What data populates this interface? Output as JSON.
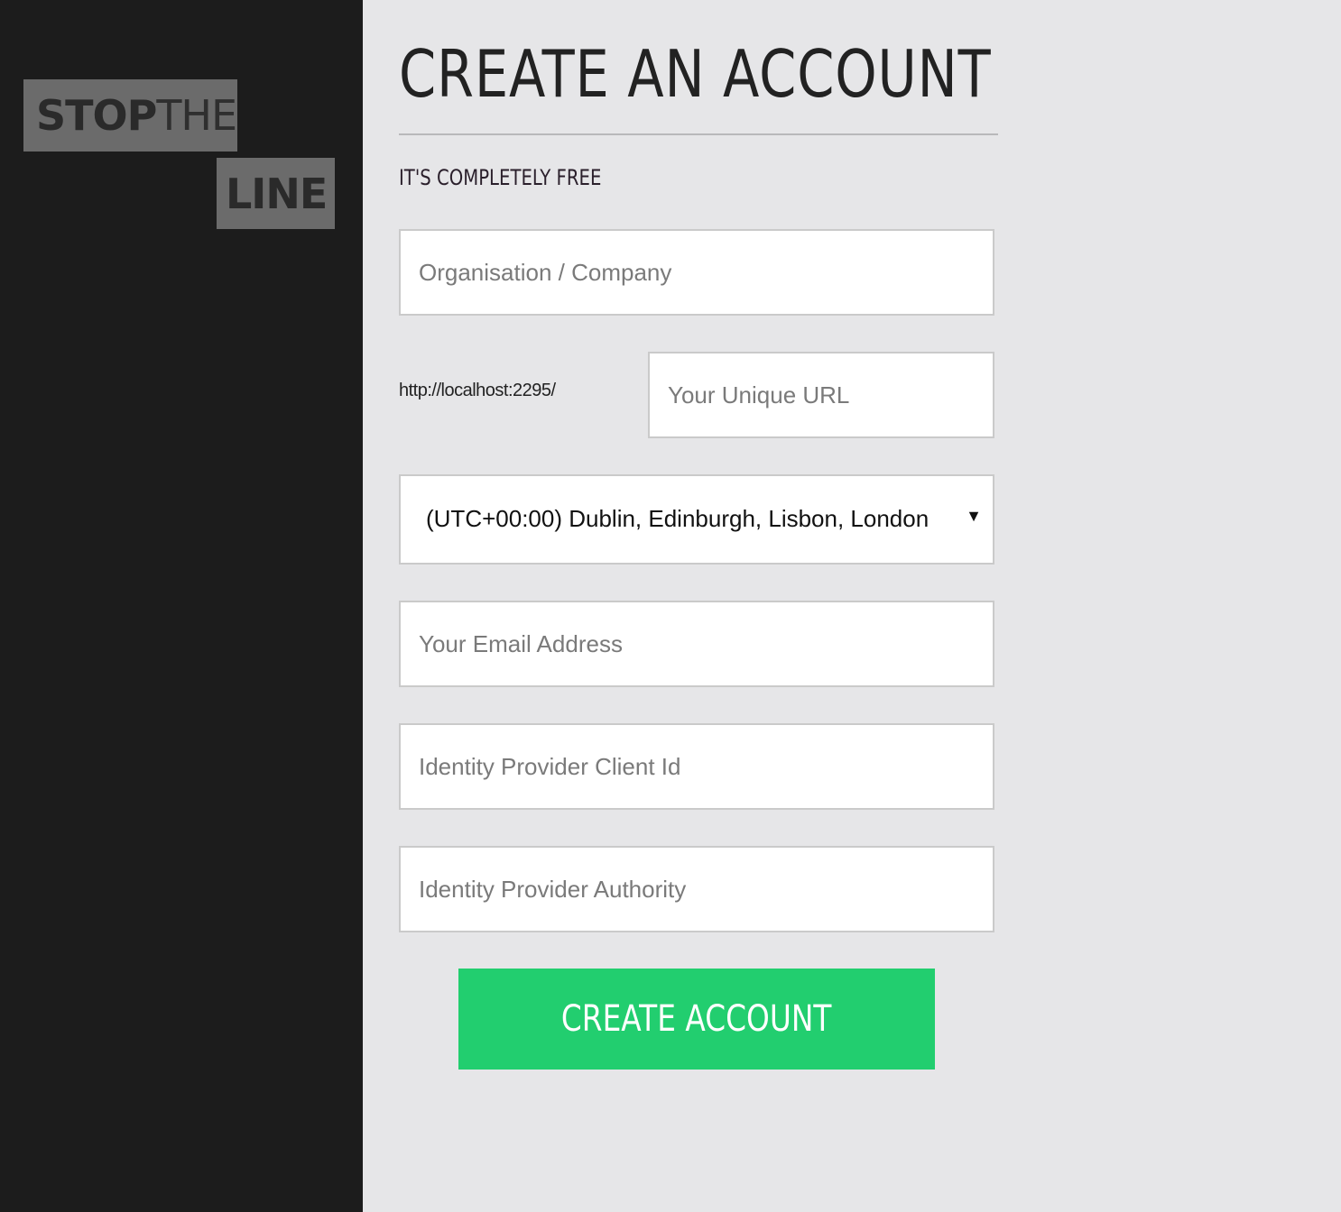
{
  "logo": {
    "line1_bold": "STOP",
    "line1_light": "THE",
    "line2": "LINE"
  },
  "header": {
    "title": "CREATE AN ACCOUNT",
    "subtitle": "IT'S COMPLETELY FREE"
  },
  "form": {
    "organisation": {
      "placeholder": "Organisation / Company",
      "value": ""
    },
    "url_prefix": "http://localhost:2295/",
    "unique_url": {
      "placeholder": "Your Unique URL",
      "value": ""
    },
    "timezone": {
      "selected": "(UTC+00:00) Dublin, Edinburgh, Lisbon, London"
    },
    "email": {
      "placeholder": "Your Email Address",
      "value": ""
    },
    "idp_client_id": {
      "placeholder": "Identity Provider Client Id",
      "value": ""
    },
    "idp_authority": {
      "placeholder": "Identity Provider Authority",
      "value": ""
    },
    "submit_label": "CREATE ACCOUNT"
  },
  "colors": {
    "sidebar_bg": "#1c1c1c",
    "logo_box": "#6b6b6b",
    "main_bg": "#e6e6e8",
    "button": "#22ce6f"
  }
}
